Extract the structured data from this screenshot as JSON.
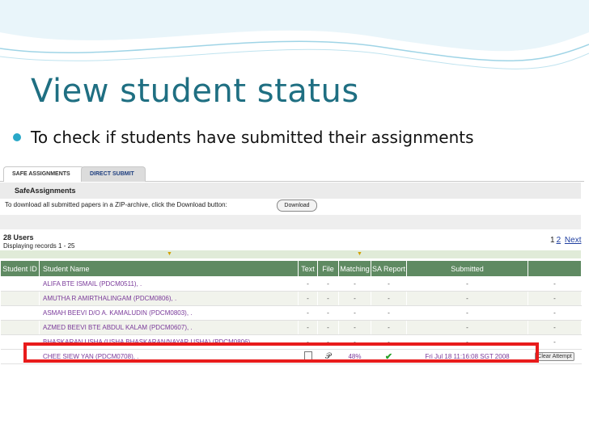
{
  "slide": {
    "title": "View student status",
    "bullet": "To check if students have submitted their assignments"
  },
  "app": {
    "tabs": [
      {
        "label": "SAFE ASSIGNMENTS",
        "active": true
      },
      {
        "label": "DIRECT SUBMIT",
        "active": false
      }
    ],
    "section_title": "SafeAssignments",
    "download_text": "To download all submitted papers in a ZIP-archive, click the Download button:",
    "download_button": "Download",
    "users_count": "28 Users",
    "displaying": "Displaying records 1 - 25",
    "pager": {
      "current": "1",
      "next_page": "2",
      "next_label": "Next"
    },
    "columns": [
      "Student ID",
      "Student Name",
      "Text",
      "File",
      "Matching",
      "SA Report",
      "Submitted",
      ""
    ],
    "rows": [
      {
        "id": "",
        "name": "ALIFA BTE ISMAIL (PDCM0511), .",
        "text": "-",
        "file": "-",
        "matching": "-",
        "sa_report": "-",
        "submitted": "-",
        "action": "-"
      },
      {
        "id": "",
        "name": "AMUTHA R AMIRTHALINGAM (PDCM0806), .",
        "text": "-",
        "file": "-",
        "matching": "-",
        "sa_report": "-",
        "submitted": "-",
        "action": "-"
      },
      {
        "id": "",
        "name": "ASMAH BEEVI D/O A. KAMALUDIN (PDCM0803), .",
        "text": "-",
        "file": "-",
        "matching": "-",
        "sa_report": "-",
        "submitted": "-",
        "action": "-"
      },
      {
        "id": "",
        "name": "AZMED BEEVI BTE ABDUL KALAM (PDCM0607), .",
        "text": "-",
        "file": "-",
        "matching": "-",
        "sa_report": "-",
        "submitted": "-",
        "action": "-"
      },
      {
        "id": "",
        "name": "BHASKARAN USHA (USHA BHASKARAN/NAYAR USHA) (PDCM0806)",
        "text": "-",
        "file": "-",
        "matching": "-",
        "sa_report": "-",
        "submitted": "-",
        "action": "-"
      },
      {
        "id": "",
        "name": "CHEE SIEW YAN (PDCM0708), .",
        "text": "doc-icon",
        "file": "clip-icon",
        "matching": "48%",
        "sa_report": "check-icon",
        "submitted": "Fri Jul 18 11:16:08 SGT 2008",
        "action": "Clear Attempt"
      }
    ]
  },
  "colors": {
    "title": "#1f6f82",
    "bullet": "#29a8c8",
    "header": "#5f8a62",
    "highlight": "#e81b1b",
    "name_link": "#7a3a9a"
  }
}
